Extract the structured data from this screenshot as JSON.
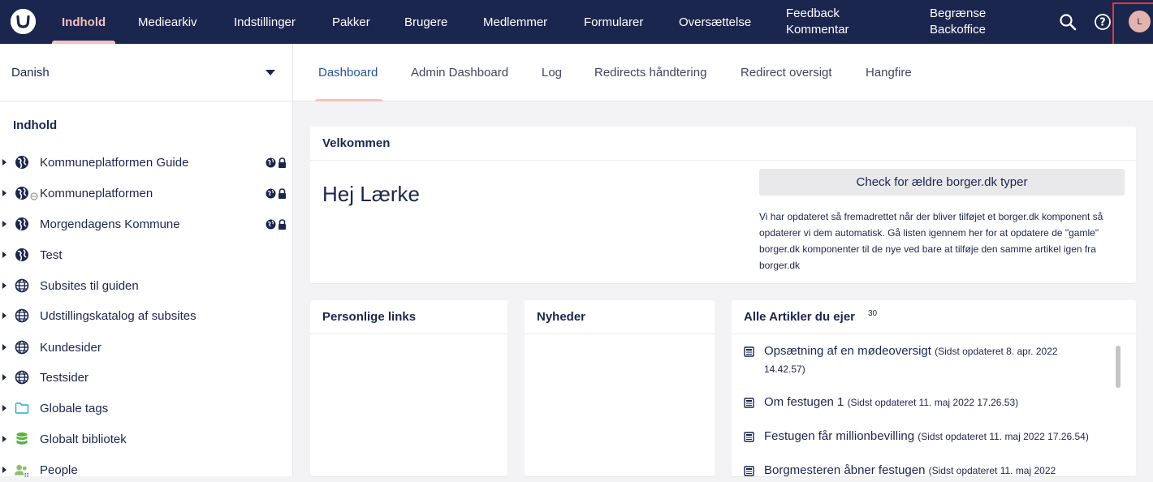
{
  "topnav": {
    "items": [
      {
        "label": "Indhold",
        "active": true
      },
      {
        "label": "Mediearkiv"
      },
      {
        "label": "Indstillinger"
      },
      {
        "label": "Pakker"
      },
      {
        "label": "Brugere"
      },
      {
        "label": "Medlemmer"
      },
      {
        "label": "Formularer"
      },
      {
        "label": "Oversættelse"
      },
      {
        "line1": "Feedback",
        "line2": "Kommentar"
      },
      {
        "line1": "Begrænse",
        "line2": "Backoffice"
      }
    ],
    "avatar_initial": "L",
    "icons": [
      "search-icon",
      "help-icon"
    ]
  },
  "language": {
    "selected": "Danish"
  },
  "tree": {
    "heading": "Indhold",
    "items": [
      {
        "label": "Kommuneplatformen Guide",
        "icon": "globe-icon",
        "flags": true
      },
      {
        "label": "Kommuneplatformen",
        "icon": "globe-icon",
        "flags": true,
        "prefix_icon": "disabled-icon"
      },
      {
        "label": "Morgendagens Kommune",
        "icon": "globe-icon",
        "flags": true
      },
      {
        "label": "Test",
        "icon": "globe-icon"
      },
      {
        "label": "Subsites til guiden",
        "icon": "world-icon"
      },
      {
        "label": "Udstillingskatalog af subsites",
        "icon": "world-icon"
      },
      {
        "label": "Kundesider",
        "icon": "world-icon"
      },
      {
        "label": "Testsider",
        "icon": "world-icon"
      },
      {
        "label": "Globale tags",
        "icon": "folder-icon"
      },
      {
        "label": "Globalt bibliotek",
        "icon": "database-icon"
      },
      {
        "label": "People",
        "icon": "people-icon"
      }
    ]
  },
  "tabs": [
    {
      "label": "Dashboard",
      "active": true
    },
    {
      "label": "Admin Dashboard"
    },
    {
      "label": "Log"
    },
    {
      "label": "Redirects håndtering"
    },
    {
      "label": "Redirect oversigt"
    },
    {
      "label": "Hangfire"
    }
  ],
  "welcome": {
    "title": "Velkommen",
    "greeting": "Hej Lærke",
    "button": "Check for ældre borger.dk typer",
    "info": "Vi har opdateret så fremadrettet når der bliver tilføjet et borger.dk komponent så opdaterer vi dem automatisk. Gå listen igennem her for at opdatere de \"gamle\" borger.dk komponenter til de nye ved bare at tilføje den samme artikel igen fra borger.dk"
  },
  "panels": {
    "personal_links": "Personlige links",
    "news": "Nyheder",
    "articles": {
      "title": "Alle Artikler du ejer",
      "count": "30",
      "items": [
        {
          "title": "Opsætning af en mødeoversigt",
          "meta": "(Sidst opdateret 8. apr. 2022 14.42.57)"
        },
        {
          "title": "Om festugen 1",
          "meta": "(Sidst opdateret 11. maj 2022 17.26.53)"
        },
        {
          "title": "Festugen får millionbevilling",
          "meta": "(Sidst opdateret 11. maj 2022 17.26.54)"
        },
        {
          "title": "Borgmesteren åbner festugen",
          "meta": "(Sidst opdateret 11. maj 2022"
        }
      ]
    }
  },
  "colors": {
    "nav_bg": "#1b264f",
    "accent": "#f5c1bc",
    "tab_active": "#2152a3"
  }
}
